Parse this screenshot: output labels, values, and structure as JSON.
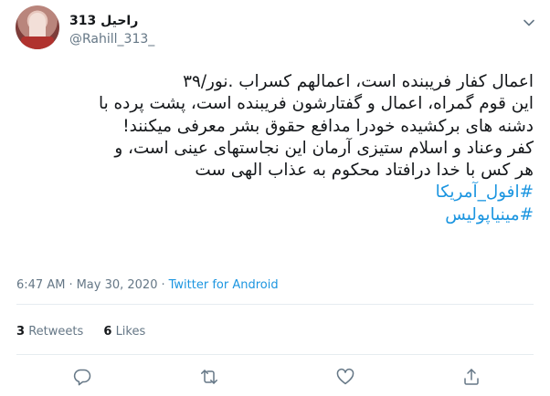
{
  "author": {
    "name": "راحیل 313",
    "handle": "@Rahill_313_"
  },
  "tweet": {
    "lines": [
      "اعمال کفار فریبنده است، اعمالهم کسراب .نور/۳۹",
      "این قوم گمراه، اعمال و گفتارشون فریبنده است،  پشت پرده با",
      "دشنه های برکشیده خودرا مدافع حقوق بشر معرفی میکنند!",
      "کفر وعناد و اسلام ستیزی آرمان این نجاستهای عینی است، و",
      "هر کس با خدا درافتاد محکوم به عذاب الهی ست"
    ],
    "hashtags": [
      "#افول_آمریکا",
      "#مینیاپولیس"
    ]
  },
  "meta": {
    "time": "6:47 AM",
    "date": "May 30, 2020",
    "source": "Twitter for Android"
  },
  "stats": {
    "retweets_count": "3",
    "retweets_label": "Retweets",
    "likes_count": "6",
    "likes_label": "Likes"
  },
  "actions": [
    "reply-icon",
    "retweet-icon",
    "like-icon",
    "share-icon"
  ],
  "colors": {
    "link": "#1b95e0",
    "secondary_text": "#657786",
    "divider": "#e6ecf0"
  }
}
